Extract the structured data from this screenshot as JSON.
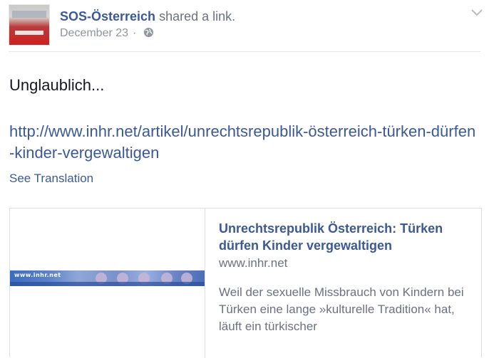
{
  "post": {
    "author": "SOS-Österreich",
    "action": "shared a link.",
    "date": "December 23",
    "separator": "·",
    "message": "Unglaublich...",
    "link_url": "http://www.inhr.net/artikel/unrechtsrepublik-österreich-türken-dürfen-kinder-vergewaltigen",
    "see_translation": "See Translation"
  },
  "attachment": {
    "title": "Unrechtsrepublik Österreich: Türken dürfen Kinder vergewaltigen",
    "domain": "www.inhr.net",
    "description": "Weil der sexuelle Missbrauch von Kindern bei Türken eine lange »kulturelle Tradition« hat, läuft ein türkischer",
    "thumbnail_label": "www.inhr.net"
  },
  "icons": {
    "globe": "globe-icon",
    "options": "chevron-down-icon"
  },
  "colors": {
    "link": "#3b5998",
    "text": "#141823",
    "meta": "#8d949e",
    "border": "#dddfe2"
  }
}
